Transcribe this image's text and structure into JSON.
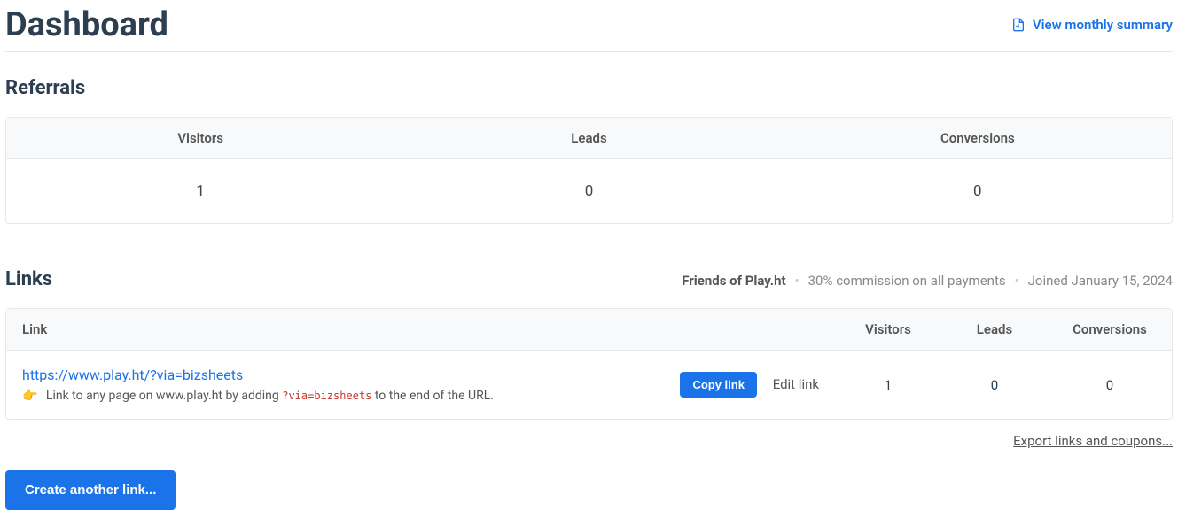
{
  "header": {
    "title": "Dashboard",
    "monthly_summary_label": "View monthly summary"
  },
  "referrals": {
    "title": "Referrals",
    "columns": {
      "visitors": "Visitors",
      "leads": "Leads",
      "conversions": "Conversions"
    },
    "values": {
      "visitors": "1",
      "leads": "0",
      "conversions": "0"
    }
  },
  "links": {
    "title": "Links",
    "program_name": "Friends of Play.ht",
    "commission_text": "30% commission on all payments",
    "joined_text": "Joined January 15, 2024",
    "columns": {
      "link": "Link",
      "visitors": "Visitors",
      "leads": "Leads",
      "conversions": "Conversions"
    },
    "rows": [
      {
        "url": "https://www.play.ht/?via=bizsheets",
        "hint_prefix": "Link to any page on www.play.ht by adding ",
        "hint_code": "?via=bizsheets",
        "hint_suffix": " to the end of the URL.",
        "copy_label": "Copy link",
        "edit_label": "Edit link",
        "visitors": "1",
        "leads": "0",
        "conversions": "0"
      }
    ],
    "export_label": "Export links and coupons...",
    "create_label": "Create another link..."
  }
}
